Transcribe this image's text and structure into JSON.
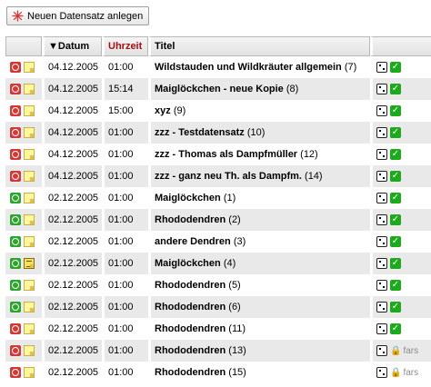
{
  "toolbar": {
    "new_label": "Neuen Datensatz anlegen",
    "new_icon": "star-burst-icon"
  },
  "columns": {
    "date": "▼Datum",
    "time": "Uhrzeit",
    "title": "Titel"
  },
  "colors": {
    "time_header": "#a31010",
    "row_alt": "#e9e9e9",
    "status_red": "#d23a3a",
    "status_green": "#2fa52f",
    "check": "#1ea81e"
  },
  "rows": [
    {
      "status": "red",
      "note": "plain",
      "date": "04.12.2005",
      "time": "01:00",
      "title": "Wildstauden und Wildkräuter allgemein",
      "count": "(7)",
      "action": "check"
    },
    {
      "status": "red",
      "note": "plain",
      "date": "04.12.2005",
      "time": "15:14",
      "title": "Maiglöckchen - neue Kopie",
      "count": "(8)",
      "action": "check"
    },
    {
      "status": "red",
      "note": "plain",
      "date": "04.12.2005",
      "time": "15:00",
      "title": "xyz",
      "count": "(9)",
      "action": "check"
    },
    {
      "status": "red",
      "note": "plain",
      "date": "04.12.2005",
      "time": "01:00",
      "title": "zzz - Testdatensatz",
      "count": "(10)",
      "action": "check"
    },
    {
      "status": "red",
      "note": "plain",
      "date": "04.12.2005",
      "time": "01:00",
      "title": "zzz - Thomas als Dampfmüller",
      "count": "(12)",
      "action": "check"
    },
    {
      "status": "red",
      "note": "plain",
      "date": "04.12.2005",
      "time": "01:00",
      "title": "zzz - ganz neu Th. als Dampfm.",
      "count": "(14)",
      "action": "check"
    },
    {
      "status": "green",
      "note": "plain",
      "date": "02.12.2005",
      "time": "01:00",
      "title": "Maiglöckchen",
      "count": "(1)",
      "action": "check"
    },
    {
      "status": "green",
      "note": "plain",
      "date": "02.12.2005",
      "time": "01:00",
      "title": "Rhododendren",
      "count": "(2)",
      "action": "check"
    },
    {
      "status": "green",
      "note": "plain",
      "date": "02.12.2005",
      "time": "01:00",
      "title": "andere Dendren",
      "count": "(3)",
      "action": "check"
    },
    {
      "status": "green",
      "note": "filled",
      "date": "02.12.2005",
      "time": "01:00",
      "title": "Maiglöckchen",
      "count": "(4)",
      "action": "check"
    },
    {
      "status": "green",
      "note": "plain",
      "date": "02.12.2005",
      "time": "01:00",
      "title": "Rhododendren",
      "count": "(5)",
      "action": "check"
    },
    {
      "status": "green",
      "note": "plain",
      "date": "02.12.2005",
      "time": "01:00",
      "title": "Rhododendren",
      "count": "(6)",
      "action": "check"
    },
    {
      "status": "red",
      "note": "plain",
      "date": "02.12.2005",
      "time": "01:00",
      "title": "Rhododendren",
      "count": "(11)",
      "action": "check"
    },
    {
      "status": "red",
      "note": "plain",
      "date": "02.12.2005",
      "time": "01:00",
      "title": "Rhododendren",
      "count": "(13)",
      "action": "lock",
      "lock_label": "fars"
    },
    {
      "status": "red",
      "note": "plain",
      "date": "02.12.2005",
      "time": "01:00",
      "title": "Rhododendren",
      "count": "(15)",
      "action": "lock",
      "lock_label": "fars"
    }
  ]
}
